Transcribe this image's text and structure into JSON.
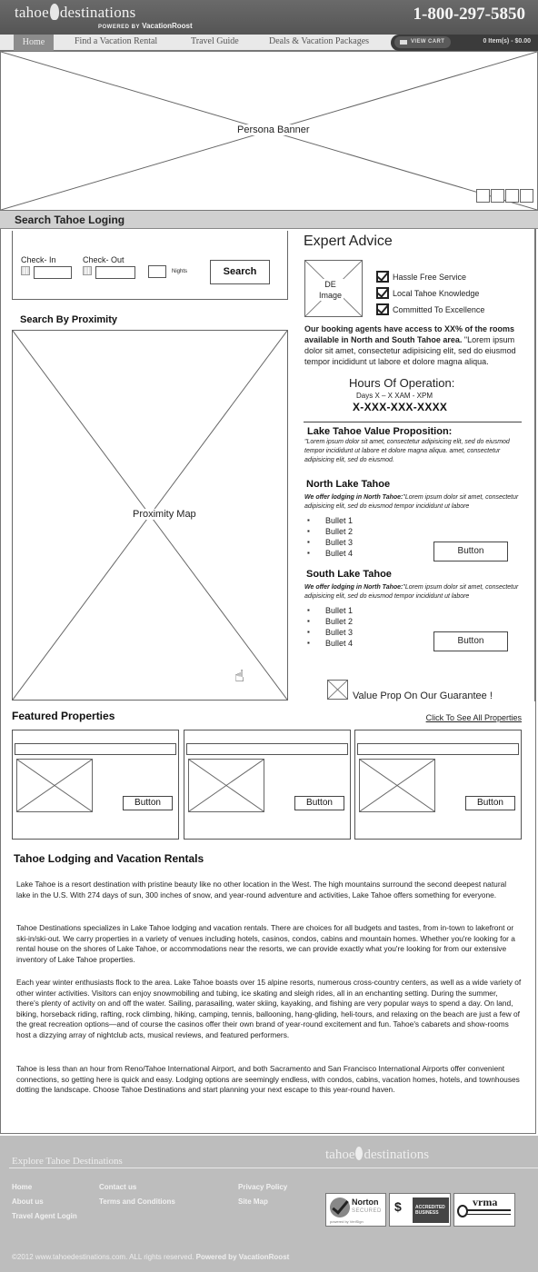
{
  "header": {
    "logo_left": "tahoe",
    "logo_right": "destinations",
    "logo_powered_by": "POWERED BY",
    "logo_brand": "VacationRoost",
    "phone": "1-800-297-5850"
  },
  "nav": {
    "items": [
      {
        "label": "Home",
        "active": true
      },
      {
        "label": "Find a Vacation Rental"
      },
      {
        "label": "Travel Guide"
      },
      {
        "label": "Deals & Vacation Packages"
      }
    ],
    "view_cart_label": "VIEW CART",
    "cart_count": "0 Item(s) - $0.00"
  },
  "banner": {
    "label": "Persona Banner",
    "slide_count": 4
  },
  "search_section": {
    "title": "Search Tahoe Loging",
    "check_in_label": "Check- In",
    "check_out_label": "Check- Out",
    "check_in_value": "",
    "check_out_value": "",
    "nights_value": "",
    "nights_label": "Nights",
    "search_button": "Search"
  },
  "proximity": {
    "title": "Search By Proximity",
    "map_label": "Proximity Map"
  },
  "expert_advice": {
    "title": "Expert Advice",
    "image_label_1": "DE",
    "image_label_2": "Image",
    "checks": [
      "Hassle Free Service",
      "Local Tahoe Knowledge",
      "Committed To Excellence"
    ],
    "booking_bold": "Our booking agents have access to XX% of the rooms available in North and South Tahoe area.",
    "booking_text": " \"Lorem ipsum dolor sit amet, consectetur adipisicing elit, sed do eiusmod tempor incididunt ut labore et dolore magna aliqua.",
    "hours_title": "Hours Of Operation:",
    "hours_days": "Days X – X XAM - XPM",
    "hours_phone": "X-XXX-XXX-XXXX"
  },
  "value_prop": {
    "title": "Lake Tahoe Value Proposition:",
    "text": "\"Lorem ipsum dolor sit amet, consectetur adipisicing elit, sed do eiusmod tempor incididunt ut labore et dolore magna aliqua. amet, consectetur adipisicing elit, sed do eiusmod."
  },
  "north": {
    "title": "North Lake Tahoe",
    "intro_bold": "We offer lodging in North Tahoe:",
    "intro_text": "\"Lorem ipsum dolor sit amet, consectetur adipisicing elit, sed do eiusmod tempor incididunt ut labore",
    "bullets": [
      "Bullet 1",
      "Bullet 2",
      "Bullet 3",
      "Bullet 4"
    ],
    "button": "Button"
  },
  "south": {
    "title": "South Lake Tahoe",
    "intro_bold": "We offer lodging in North Tahoe:",
    "intro_text": "\"Lorem ipsum dolor sit amet, consectetur adipisicing elit, sed do eiusmod tempor incididunt ut labore",
    "bullets": [
      "Bullet 1",
      "Bullet 2",
      "Bullet 3",
      "Bullet 4"
    ],
    "button": "Button"
  },
  "guarantee": {
    "text": "Value Prop On Our Guarantee !"
  },
  "featured": {
    "title": "Featured Properties",
    "see_all": "Click To See All Properties",
    "cards": [
      {
        "button": "Button"
      },
      {
        "button": "Button"
      },
      {
        "button": "Button"
      }
    ]
  },
  "lodging": {
    "title": "Tahoe Lodging and Vacation Rentals",
    "paragraphs": [
      "Lake Tahoe is a resort destination with pristine beauty like no other location in the West. The high mountains surround the second deepest natural lake in the U.S. With 274 days of sun, 300 inches of snow, and year-round adventure and activities, Lake Tahoe offers something for everyone.",
      "Tahoe Destinations specializes in Lake Tahoe lodging and vacation rentals. There are choices for all budgets and tastes, from in-town to lakefront or ski-in/ski-out. We carry properties in a variety of venues including hotels, casinos, condos, cabins and mountain homes. Whether you're looking for a rental house on the shores of Lake Tahoe, or accommodations near the resorts, we can provide exactly what you're looking for from our extensive inventory of Lake Tahoe properties.",
      "Each year winter enthusiasts flock to the area. Lake Tahoe boasts over 15 alpine resorts, numerous cross-country centers, as well as a wide variety of other winter activities. Visitors can enjoy snowmobiling and tubing, ice skating and sleigh rides, all in an enchanting setting. During the summer, there's plenty of activity on and off the water. Sailing, parasailing, water skiing, kayaking, and fishing are very popular ways to spend a day. On land, biking, horseback riding, rafting, rock climbing, hiking, camping, tennis, ballooning, hang-gliding, heli-tours, and relaxing on the beach are just a few of the great recreation options—and of course the casinos offer their own brand of year-round excitement and fun. Tahoe's cabarets and show-rooms host a dizzying array of nightclub acts, musical reviews, and featured performers.",
      "Tahoe is less than an hour from Reno/Tahoe International Airport, and both Sacramento and San Francisco International Airports offer convenient connections, so getting here is quick and easy. Lodging options are seemingly endless, with condos, cabins, vacation homes, hotels, and townhouses dotting the landscape. Choose Tahoe Destinations and start planning your next escape to this year-round haven."
    ]
  },
  "footer": {
    "explore_title": "Explore Tahoe Destinations",
    "logo_left": "tahoe",
    "logo_right": "destinations",
    "links_col1": [
      "Home",
      "About us",
      "Travel Agent Login"
    ],
    "links_col2": [
      "Contact us",
      "Terms and Conditions"
    ],
    "links_col3": [
      "Privacy Policy",
      "Site Map"
    ],
    "badges": {
      "norton_title": "Norton",
      "norton_sub": "SECURED",
      "norton_powered": "powered by VeriSign",
      "bbb_mark": "$",
      "bbb_text_1": "ACCREDITED",
      "bbb_text_2": "BUSINESS",
      "vrma": "vrma"
    },
    "copyright": "©2012 www.tahoedestinations.com. ALL rights reserved.",
    "powered": "Powered by VacationRoost"
  }
}
